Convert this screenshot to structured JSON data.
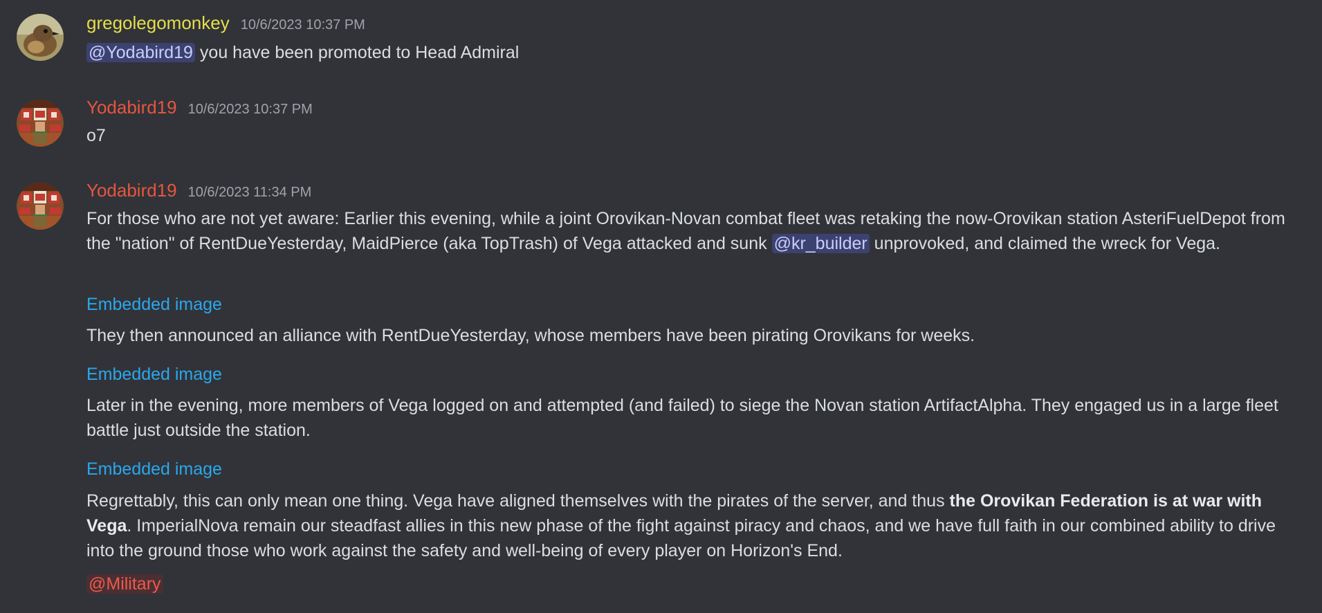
{
  "messages": [
    {
      "author": "gregolegomonkey",
      "timestamp": "10/6/2023 10:37 PM",
      "mention": "@Yodabird19",
      "text": " you have been promoted to Head Admiral"
    },
    {
      "author": "Yodabird19",
      "timestamp": "10/6/2023 10:37 PM",
      "text": "o7"
    },
    {
      "author": "Yodabird19",
      "timestamp": "10/6/2023 11:34 PM",
      "p1_before": "For those who are not yet aware: Earlier this evening, while a joint Orovikan-Novan combat fleet was retaking the now-Orovikan station AsteriFuelDepot from the \"nation\" of RentDueYesterday, MaidPierce (aka TopTrash) of Vega attacked and sunk ",
      "p1_mention": "@kr_builder",
      "p1_after": " unprovoked, and claimed the wreck for Vega.",
      "embed1": "Embedded image",
      "p2": "They then announced an alliance with RentDueYesterday, whose members have been pirating Orovikans for weeks.",
      "embed2": "Embedded image",
      "p3": "Later in the evening, more members of Vega logged on and attempted (and failed) to siege the Novan station ArtifactAlpha. They engaged us in a large fleet battle just outside the station.",
      "embed3": "Embedded image",
      "p4_before": "Regrettably, this can only mean one thing. Vega have aligned themselves with the pirates of the server, and thus ",
      "p4_bold": "the Orovikan Federation is at war with Vega",
      "p4_after": ". ImperialNova remain our steadfast allies in this new phase of the fight against piracy and chaos, and we have full faith in our combined ability to drive into the ground those who work against the safety and well-being of every player on Horizon's End.",
      "role_mention": "@Military"
    }
  ],
  "colors": {
    "background": "#313338",
    "greg_name": "#e8de4a",
    "yoda_name": "#e8553e",
    "link": "#2aa7ee",
    "mention_bg": "#3c4270",
    "role_mention_bg": "#4a2f33"
  },
  "icons": {
    "greg_avatar": "bird-avatar",
    "yoda_avatar": "minecraft-skin-avatar"
  }
}
